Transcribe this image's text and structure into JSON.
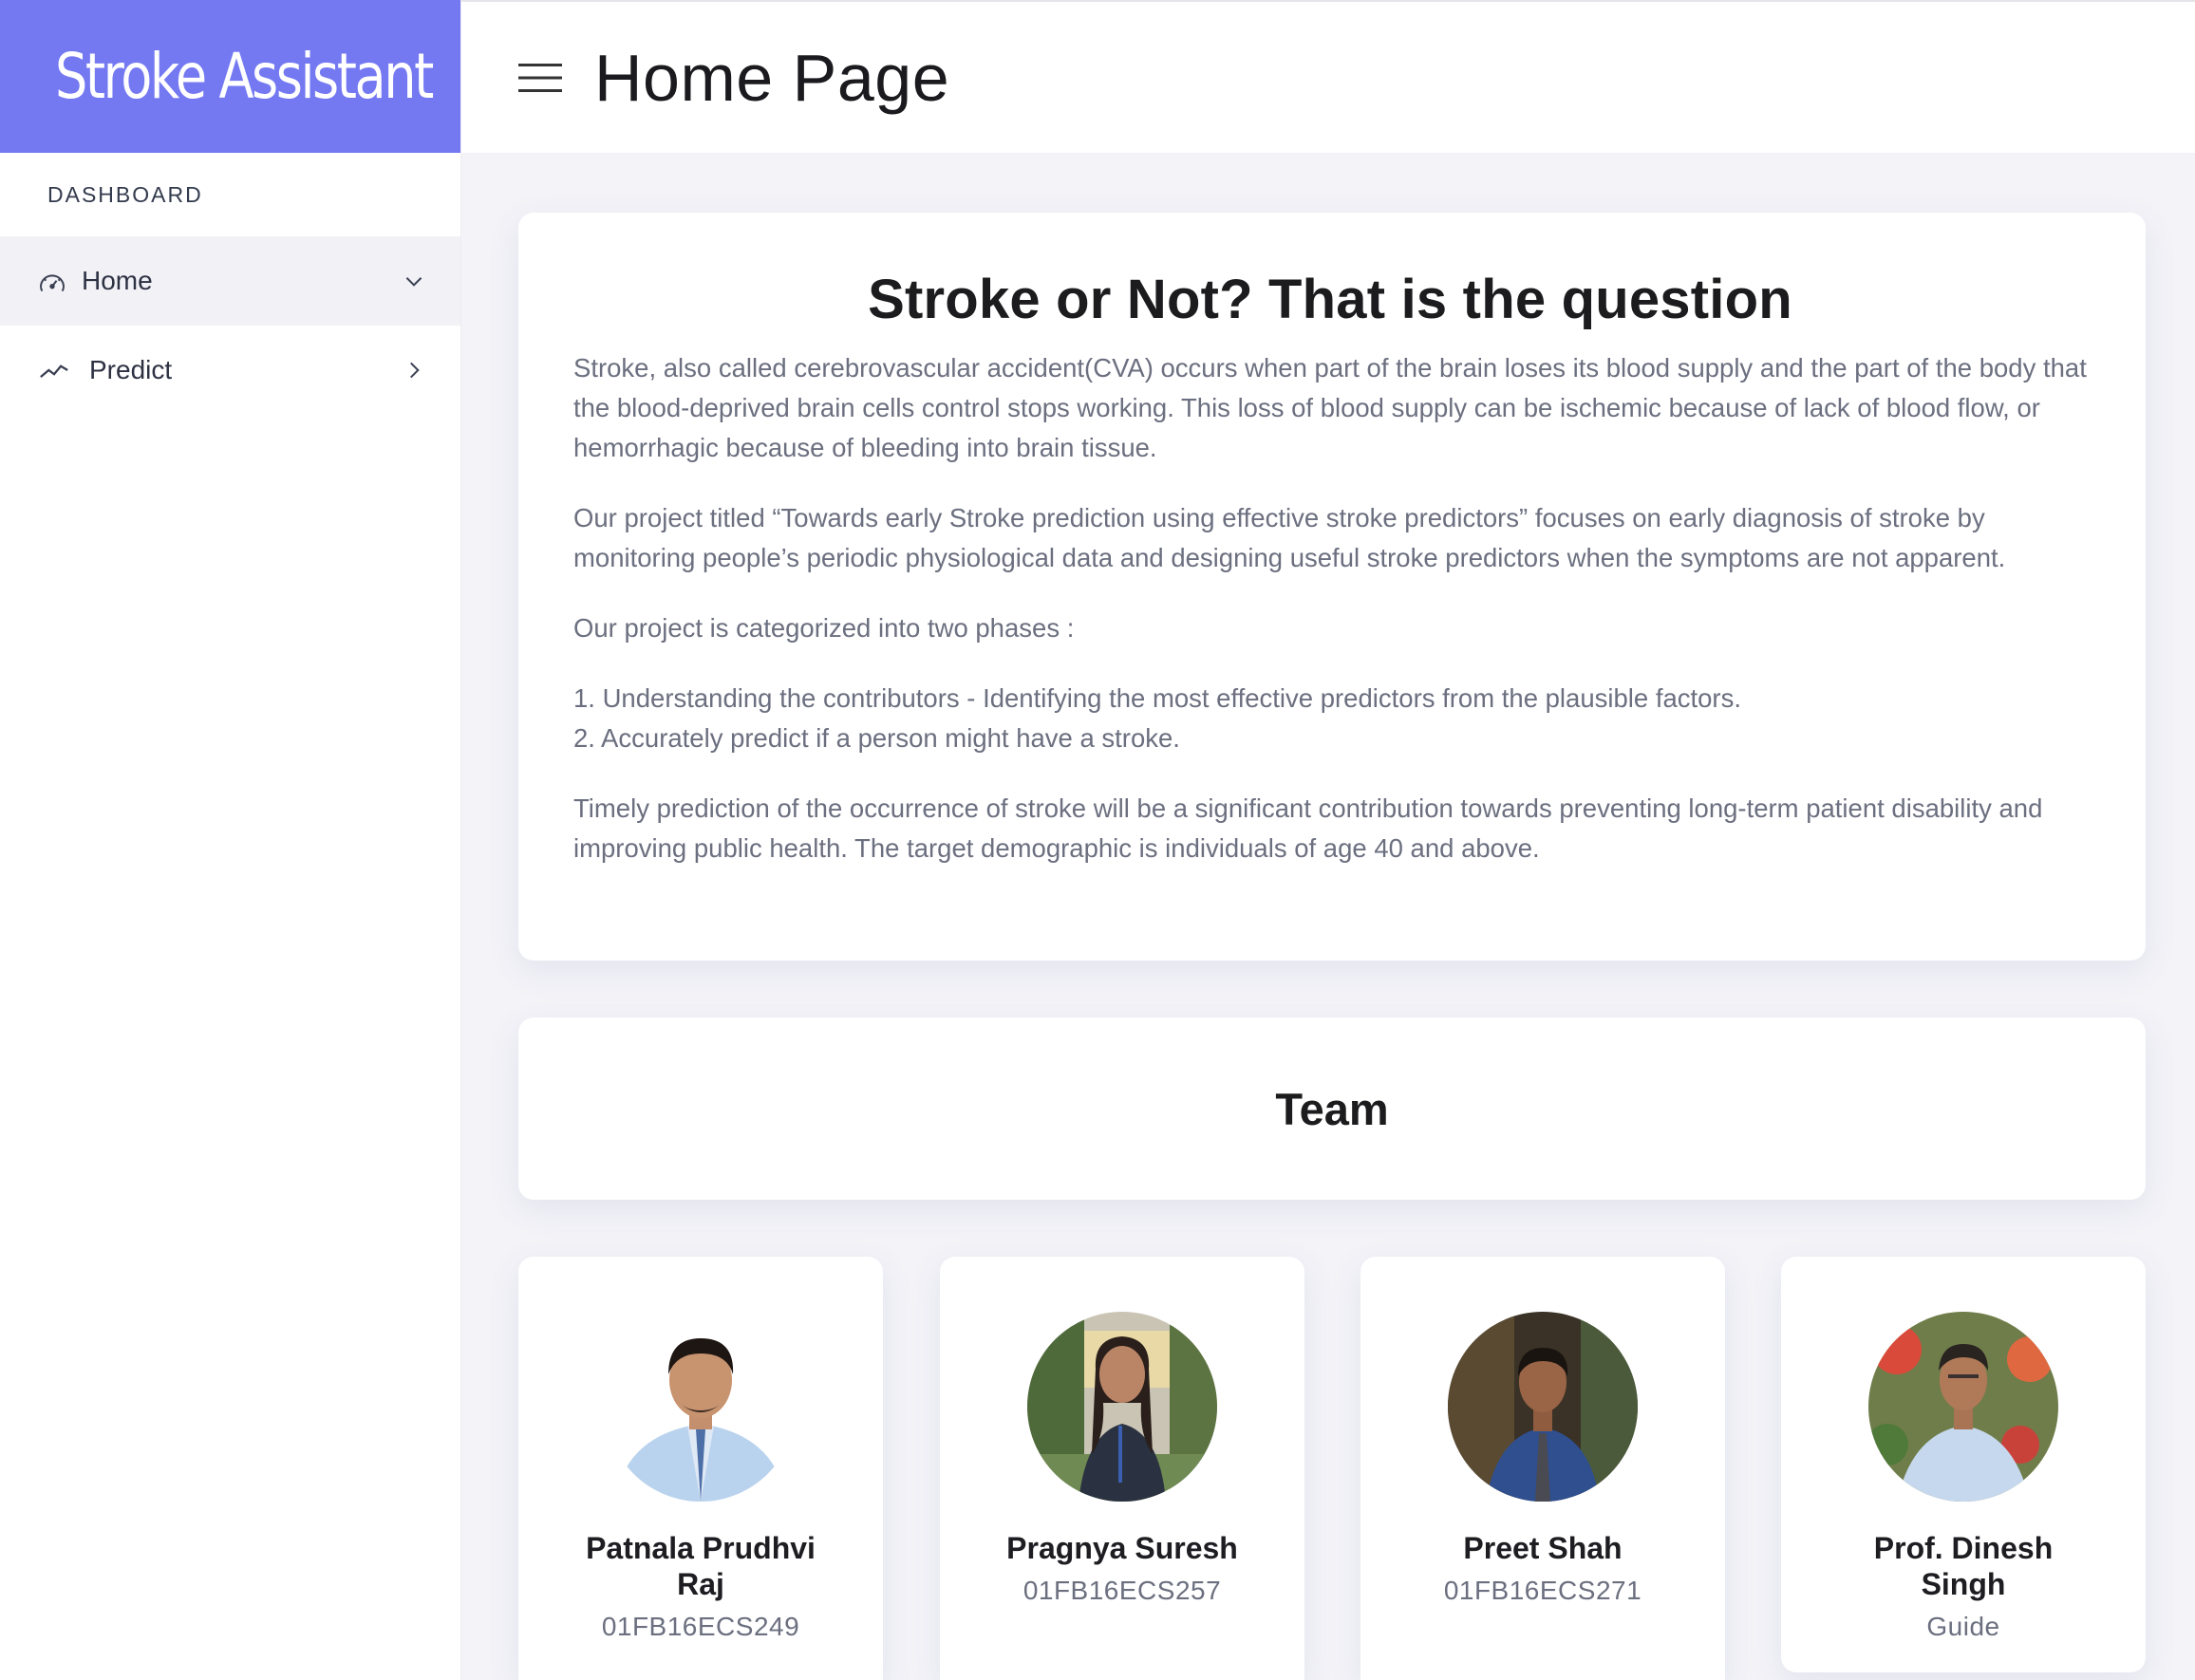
{
  "sidebar": {
    "brand": "Stroke Assistant",
    "section_label": "DASHBOARD",
    "items": [
      {
        "label": "Home",
        "icon": "dashboard-gauge-icon",
        "chevron": "chevron-down-icon",
        "active": true
      },
      {
        "label": "Predict",
        "icon": "trend-line-icon",
        "chevron": "chevron-right-icon",
        "active": false
      }
    ]
  },
  "header": {
    "menu_icon": "hamburger-menu-icon",
    "title": "Home Page"
  },
  "intro": {
    "title": "Stroke or Not? That is the question",
    "paragraphs": [
      "Stroke, also called cerebrovascular accident(CVA) occurs when part of the brain loses its blood supply and the part of the body that the blood-deprived brain cells control stops working. This loss of blood supply can be ischemic because of lack of blood flow, or hemorrhagic because of bleeding into brain tissue.",
      "Our project titled “Towards early Stroke prediction using effective stroke predictors” focuses on early diagnosis of stroke by monitoring people’s periodic physiological data and designing useful stroke predictors when the symptoms are not apparent.",
      "Our project is categorized into two phases :",
      "1. Understanding the contributors - Identifying the most effective predictors from the plausible factors.",
      "2. Accurately predict if a person might have a stroke.",
      "Timely prediction of the occurrence of stroke will be a significant contribution towards preventing long-term patient disability and improving public health. The target demographic is individuals of age 40 and above."
    ]
  },
  "team": {
    "title": "Team",
    "members": [
      {
        "name": "Patnala Prudhvi Raj",
        "id": "01FB16ECS249"
      },
      {
        "name": "Pragnya Suresh",
        "id": "01FB16ECS257"
      },
      {
        "name": "Preet Shah",
        "id": "01FB16ECS271"
      },
      {
        "name": "Prof. Dinesh Singh",
        "id": "Guide"
      }
    ]
  },
  "colors": {
    "brand": "#7479f2",
    "body_text": "#6b6f7f",
    "background": "#f3f3f8"
  }
}
